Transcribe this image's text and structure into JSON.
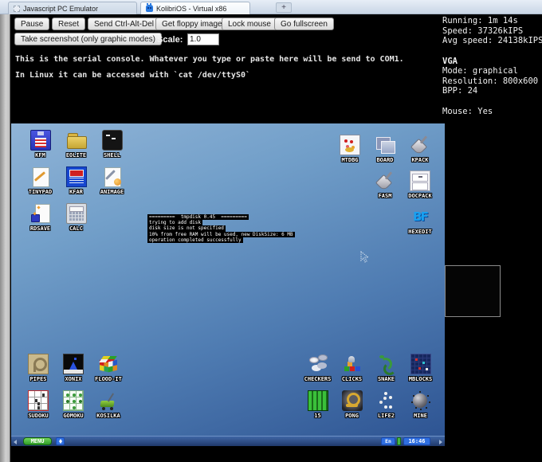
{
  "browser": {
    "tabs": [
      {
        "label": "Javascript PC Emulator"
      },
      {
        "label": "KolibriOS - Virtual x86"
      }
    ],
    "new_tab_label": "+"
  },
  "toolbar": {
    "buttons": [
      "Pause",
      "Reset",
      "Send Ctrl-Alt-Del",
      "Get floppy image",
      "Lock mouse",
      "Go fullscreen"
    ],
    "screenshot_button": "Take screenshot (only graphic modes)",
    "scale_label": "Scale:",
    "scale_value": "1.0"
  },
  "serial_console": {
    "lines": [
      "This is the serial console. Whatever you type or paste here will be send to COM1.",
      "In Linux it can be accessed with `cat /dev/ttyS0`"
    ]
  },
  "stats_panel": {
    "running": "Running: 1m 14s",
    "speed": "Speed: 37326kIPS",
    "avg_speed": "Avg speed: 24138kIPS",
    "vga_title": "VGA",
    "mode": "Mode: graphical",
    "resolution": "Resolution: 800x600",
    "bpp": "BPP: 24",
    "mouse": "Mouse: Yes"
  },
  "desktop": {
    "console_lines": [
      "=========  tmpdisk 0.45  =========",
      "trying to add disk",
      "disk size is not specified",
      "10% from free RAM will be used, new DiskSize: 6 MB",
      "operation completed successfully"
    ],
    "top_left": [
      "KFM",
      "EOLITE",
      "SHELL",
      "TINYPAD",
      "KFAR",
      "ANIMAGE",
      "RDSAVE",
      "CALC"
    ],
    "top_right": [
      "MTDBG",
      "BOARD",
      "KPACK",
      "FASM",
      "DOCPACK",
      "HEXEDIT"
    ],
    "bottom_left": [
      "PIPES",
      "XONIX",
      "FLOOD-IT",
      "SUDOKU",
      "GOMOKU",
      "KOSILKA"
    ],
    "bottom_right": [
      "CHECKERS",
      "CLICKS",
      "SNAKE",
      "MBLOCKS",
      "15",
      "PONG",
      "LIFE2",
      "MINE"
    ],
    "hexedit_logo": "BF"
  },
  "taskbar": {
    "menu_label": "MENU",
    "lang_indicator": "En",
    "clock": "16:46"
  },
  "colors": {
    "taskbar_blue": "#2f5fa0",
    "menu_green": "#3fae31",
    "badge_blue": "#2f6fe0",
    "desktop_top": "#90b4d7",
    "desktop_bottom": "#2c5291"
  }
}
